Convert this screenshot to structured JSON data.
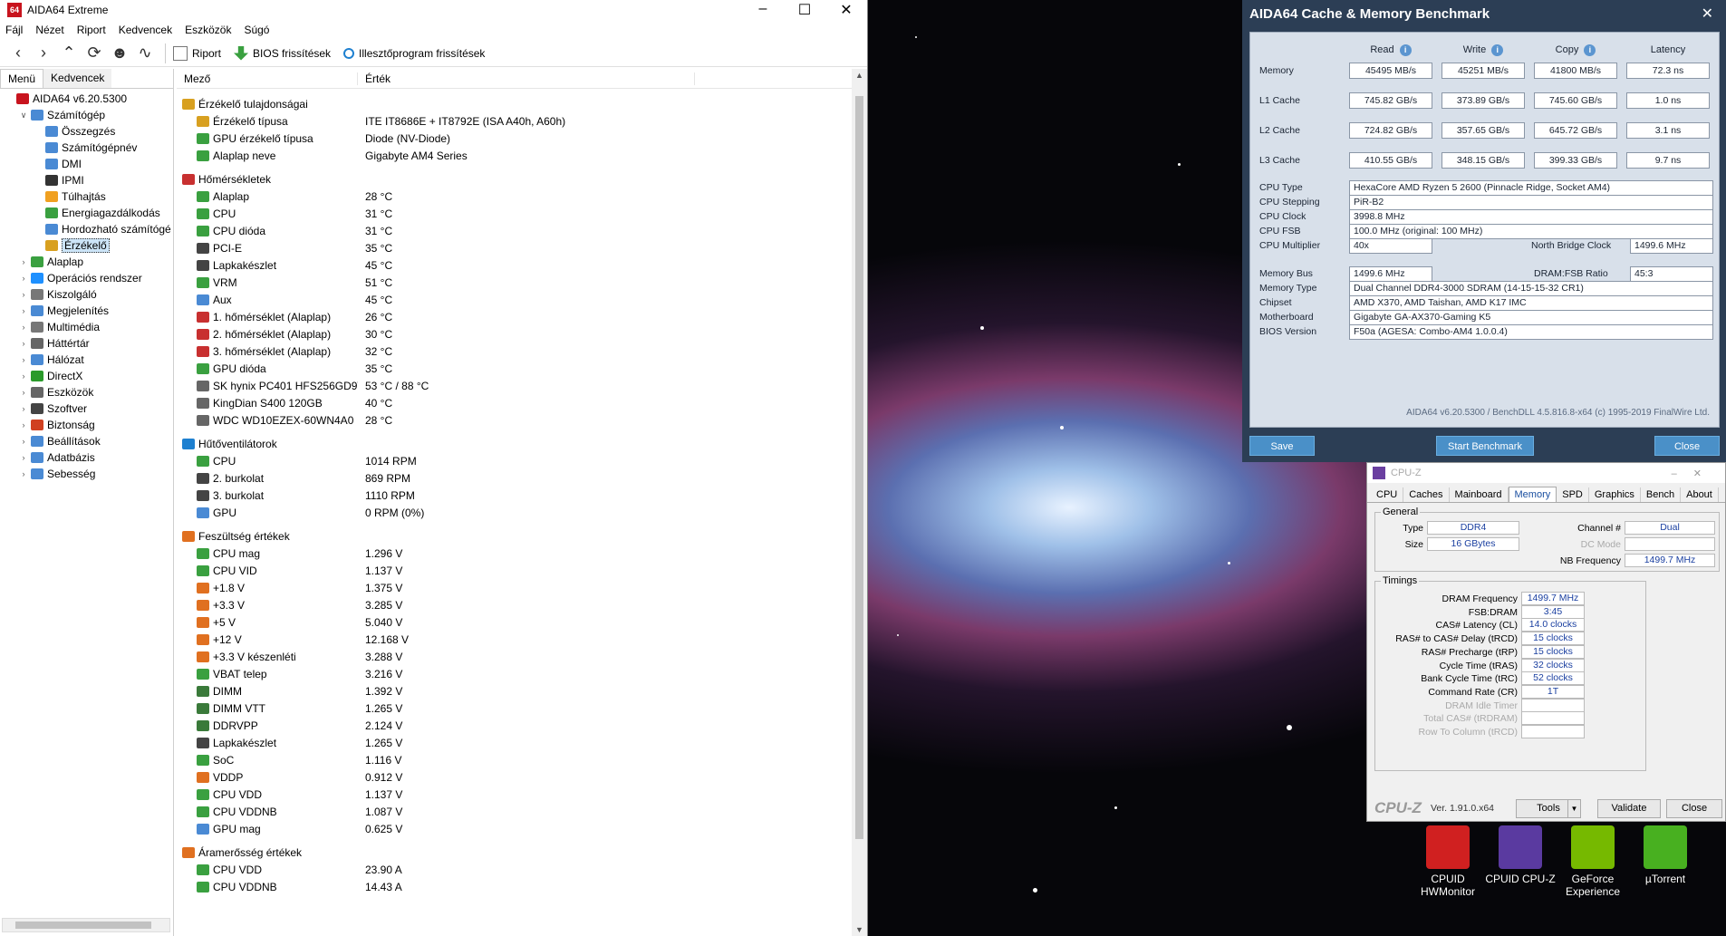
{
  "aida": {
    "title": "AIDA64 Extreme",
    "app_icon_text": "64",
    "menu": [
      "Fájl",
      "Nézet",
      "Riport",
      "Kedvencek",
      "Eszközök",
      "Súgó"
    ],
    "toolbar": {
      "report": "Riport",
      "bios_update": "BIOS frissítések",
      "driver_update": "Illesztőprogram frissítések"
    },
    "tabs": {
      "menu": "Menü",
      "favorites": "Kedvencek"
    },
    "tree": [
      {
        "label": "AIDA64 v6.20.5300",
        "indent": 0,
        "exp": "",
        "color": "#c8141e"
      },
      {
        "label": "Számítógép",
        "indent": 1,
        "exp": "v",
        "color": "#4a8ad4"
      },
      {
        "label": "Összegzés",
        "indent": 2,
        "exp": "",
        "color": "#4a8ad4"
      },
      {
        "label": "Számítógépnév",
        "indent": 2,
        "exp": "",
        "color": "#4a8ad4"
      },
      {
        "label": "DMI",
        "indent": 2,
        "exp": "",
        "color": "#4a8ad4"
      },
      {
        "label": "IPMI",
        "indent": 2,
        "exp": "",
        "color": "#333"
      },
      {
        "label": "Túlhajtás",
        "indent": 2,
        "exp": "",
        "color": "#f0a020"
      },
      {
        "label": "Energiagazdálkodás",
        "indent": 2,
        "exp": "",
        "color": "#3aa040"
      },
      {
        "label": "Hordozható számítógé",
        "indent": 2,
        "exp": "",
        "color": "#4a8ad4"
      },
      {
        "label": "Érzékelő",
        "indent": 2,
        "exp": "",
        "color": "#d8a020",
        "selected": true
      },
      {
        "label": "Alaplap",
        "indent": 1,
        "exp": ">",
        "color": "#3aa040"
      },
      {
        "label": "Operációs rendszer",
        "indent": 1,
        "exp": ">",
        "color": "#1e90ff"
      },
      {
        "label": "Kiszolgáló",
        "indent": 1,
        "exp": ">",
        "color": "#777"
      },
      {
        "label": "Megjelenítés",
        "indent": 1,
        "exp": ">",
        "color": "#4a8ad4"
      },
      {
        "label": "Multimédia",
        "indent": 1,
        "exp": ">",
        "color": "#777"
      },
      {
        "label": "Háttértár",
        "indent": 1,
        "exp": ">",
        "color": "#666"
      },
      {
        "label": "Hálózat",
        "indent": 1,
        "exp": ">",
        "color": "#4a8ad4"
      },
      {
        "label": "DirectX",
        "indent": 1,
        "exp": ">",
        "color": "#2a9a2a"
      },
      {
        "label": "Eszközök",
        "indent": 1,
        "exp": ">",
        "color": "#666"
      },
      {
        "label": "Szoftver",
        "indent": 1,
        "exp": ">",
        "color": "#444"
      },
      {
        "label": "Biztonság",
        "indent": 1,
        "exp": ">",
        "color": "#d04020"
      },
      {
        "label": "Beállítások",
        "indent": 1,
        "exp": ">",
        "color": "#4a8ad4"
      },
      {
        "label": "Adatbázis",
        "indent": 1,
        "exp": ">",
        "color": "#4a8ad4"
      },
      {
        "label": "Sebesség",
        "indent": 1,
        "exp": ">",
        "color": "#4a8ad4"
      }
    ],
    "columns": {
      "field": "Mező",
      "value": "Érték"
    },
    "rows": [
      {
        "grp": true,
        "f": "Érzékelő tulajdonságai",
        "v": "",
        "color": "#d8a020"
      },
      {
        "f": "Érzékelő típusa",
        "v": "ITE IT8686E + IT8792E  (ISA A40h, A60h)",
        "color": "#d8a020"
      },
      {
        "f": "GPU érzékelő típusa",
        "v": "Diode  (NV-Diode)",
        "color": "#3aa040"
      },
      {
        "f": "Alaplap neve",
        "v": "Gigabyte AM4 Series",
        "color": "#3aa040"
      },
      {
        "grp": true,
        "f": "Hőmérsékletek",
        "v": "",
        "color": "#c83030"
      },
      {
        "f": "Alaplap",
        "v": "28 °C",
        "color": "#3aa040"
      },
      {
        "f": "CPU",
        "v": "31 °C",
        "color": "#3aa040"
      },
      {
        "f": "CPU dióda",
        "v": "31 °C",
        "color": "#3aa040"
      },
      {
        "f": "PCI-E",
        "v": "35 °C",
        "color": "#444"
      },
      {
        "f": "Lapkakészlet",
        "v": "45 °C",
        "color": "#444"
      },
      {
        "f": "VRM",
        "v": "51 °C",
        "color": "#3aa040"
      },
      {
        "f": "Aux",
        "v": "45 °C",
        "color": "#4a8ad4"
      },
      {
        "f": "1. hőmérséklet (Alaplap)",
        "v": "26 °C",
        "color": "#c83030"
      },
      {
        "f": "2. hőmérséklet (Alaplap)",
        "v": "30 °C",
        "color": "#c83030"
      },
      {
        "f": "3. hőmérséklet (Alaplap)",
        "v": "32 °C",
        "color": "#c83030"
      },
      {
        "f": "GPU dióda",
        "v": "35 °C",
        "color": "#3aa040"
      },
      {
        "f": "SK hynix PC401 HFS256GD9T...",
        "v": "53 °C / 88 °C",
        "color": "#666"
      },
      {
        "f": "KingDian S400 120GB",
        "v": "40 °C",
        "color": "#666"
      },
      {
        "f": "WDC WD10EZEX-60WN4A0",
        "v": "28 °C",
        "color": "#666"
      },
      {
        "grp": true,
        "f": "Hűtőventilátorok",
        "v": "",
        "color": "#1e80d0"
      },
      {
        "f": "CPU",
        "v": "1014 RPM",
        "color": "#3aa040"
      },
      {
        "f": "2. burkolat",
        "v": "869 RPM",
        "color": "#444"
      },
      {
        "f": "3. burkolat",
        "v": "1110 RPM",
        "color": "#444"
      },
      {
        "f": "GPU",
        "v": "0 RPM  (0%)",
        "color": "#4a8ad4"
      },
      {
        "grp": true,
        "f": "Feszültség értékek",
        "v": "",
        "color": "#e07020"
      },
      {
        "f": "CPU mag",
        "v": "1.296 V",
        "color": "#3aa040"
      },
      {
        "f": "CPU VID",
        "v": "1.137 V",
        "color": "#3aa040"
      },
      {
        "f": "+1.8 V",
        "v": "1.375 V",
        "color": "#e07020"
      },
      {
        "f": "+3.3 V",
        "v": "3.285 V",
        "color": "#e07020"
      },
      {
        "f": "+5 V",
        "v": "5.040 V",
        "color": "#e07020"
      },
      {
        "f": "+12 V",
        "v": "12.168 V",
        "color": "#e07020"
      },
      {
        "f": "+3.3 V készenléti",
        "v": "3.288 V",
        "color": "#e07020"
      },
      {
        "f": "VBAT telep",
        "v": "3.216 V",
        "color": "#3aa040"
      },
      {
        "f": "DIMM",
        "v": "1.392 V",
        "color": "#3a7a3a"
      },
      {
        "f": "DIMM VTT",
        "v": "1.265 V",
        "color": "#3a7a3a"
      },
      {
        "f": "DDRVPP",
        "v": "2.124 V",
        "color": "#3a7a3a"
      },
      {
        "f": "Lapkakészlet",
        "v": "1.265 V",
        "color": "#444"
      },
      {
        "f": "SoC",
        "v": "1.116 V",
        "color": "#3aa040"
      },
      {
        "f": "VDDP",
        "v": "0.912 V",
        "color": "#e07020"
      },
      {
        "f": "CPU VDD",
        "v": "1.137 V",
        "color": "#3aa040"
      },
      {
        "f": "CPU VDDNB",
        "v": "1.087 V",
        "color": "#3aa040"
      },
      {
        "f": "GPU mag",
        "v": "0.625 V",
        "color": "#4a8ad4"
      },
      {
        "grp": true,
        "f": "Áramerősség értékek",
        "v": "",
        "color": "#e07020"
      },
      {
        "f": "CPU VDD",
        "v": "23.90 A",
        "color": "#3aa040"
      },
      {
        "f": "CPU VDDNB",
        "v": "14.43 A",
        "color": "#3aa040"
      }
    ]
  },
  "bench": {
    "title": "AIDA64 Cache & Memory Benchmark",
    "headers": [
      "Read",
      "Write",
      "Copy",
      "Latency"
    ],
    "rows": [
      {
        "label": "Memory",
        "values": [
          "45495 MB/s",
          "45251 MB/s",
          "41800 MB/s",
          "72.3 ns"
        ]
      },
      {
        "label": "L1 Cache",
        "values": [
          "745.82 GB/s",
          "373.89 GB/s",
          "745.60 GB/s",
          "1.0 ns"
        ]
      },
      {
        "label": "L2 Cache",
        "values": [
          "724.82 GB/s",
          "357.65 GB/s",
          "645.72 GB/s",
          "3.1 ns"
        ]
      },
      {
        "label": "L3 Cache",
        "values": [
          "410.55 GB/s",
          "348.15 GB/s",
          "399.33 GB/s",
          "9.7 ns"
        ]
      }
    ],
    "cpu_type_label": "CPU Type",
    "cpu_type": "HexaCore AMD Ryzen 5 2600  (Pinnacle Ridge, Socket AM4)",
    "cpu_stepping_label": "CPU Stepping",
    "cpu_stepping": "PiR-B2",
    "cpu_clock_label": "CPU Clock",
    "cpu_clock": "3998.8 MHz",
    "cpu_fsb_label": "CPU FSB",
    "cpu_fsb": "100.0 MHz  (original: 100 MHz)",
    "cpu_mult_label": "CPU Multiplier",
    "cpu_mult": "40x",
    "nb_clock_label": "North Bridge Clock",
    "nb_clock": "1499.6 MHz",
    "mem_bus_label": "Memory Bus",
    "mem_bus": "1499.6 MHz",
    "dram_ratio_label": "DRAM:FSB Ratio",
    "dram_ratio": "45:3",
    "mem_type_label": "Memory Type",
    "mem_type": "Dual Channel DDR4-3000 SDRAM  (14-15-15-32 CR1)",
    "chipset_label": "Chipset",
    "chipset": "AMD X370, AMD Taishan, AMD K17 IMC",
    "mobo_label": "Motherboard",
    "mobo": "Gigabyte GA-AX370-Gaming K5",
    "bios_label": "BIOS Version",
    "bios": "F50a  (AGESA: Combo-AM4 1.0.0.4)",
    "footer": "AIDA64 v6.20.5300 / BenchDLL 4.5.816.8-x64  (c) 1995-2019 FinalWire Ltd.",
    "save": "Save",
    "start": "Start Benchmark",
    "close": "Close"
  },
  "cpuz": {
    "title": "CPU-Z",
    "tabs": [
      "CPU",
      "Caches",
      "Mainboard",
      "Memory",
      "SPD",
      "Graphics",
      "Bench",
      "About"
    ],
    "active_tab": "Memory",
    "general_legend": "General",
    "type_label": "Type",
    "type": "DDR4",
    "size_label": "Size",
    "size": "16 GBytes",
    "channel_label": "Channel #",
    "channel": "Dual",
    "dcmode_label": "DC Mode",
    "dcmode": "",
    "nbfreq_label": "NB Frequency",
    "nbfreq": "1499.7 MHz",
    "timings_legend": "Timings",
    "timings": [
      {
        "label": "DRAM Frequency",
        "value": "1499.7 MHz",
        "dim": false
      },
      {
        "label": "FSB:DRAM",
        "value": "3:45",
        "dim": false
      },
      {
        "label": "CAS# Latency (CL)",
        "value": "14.0 clocks",
        "dim": false
      },
      {
        "label": "RAS# to CAS# Delay (tRCD)",
        "value": "15 clocks",
        "dim": false
      },
      {
        "label": "RAS# Precharge (tRP)",
        "value": "15 clocks",
        "dim": false
      },
      {
        "label": "Cycle Time (tRAS)",
        "value": "32 clocks",
        "dim": false
      },
      {
        "label": "Bank Cycle Time (tRC)",
        "value": "52 clocks",
        "dim": false
      },
      {
        "label": "Command Rate (CR)",
        "value": "1T",
        "dim": false
      },
      {
        "label": "DRAM Idle Timer",
        "value": "",
        "dim": true
      },
      {
        "label": "Total CAS# (tRDRAM)",
        "value": "",
        "dim": true
      },
      {
        "label": "Row To Column (tRCD)",
        "value": "",
        "dim": true
      }
    ],
    "logo": "CPU-Z",
    "version": "Ver. 1.91.0.x64",
    "tools": "Tools",
    "validate": "Validate",
    "close": "Close"
  },
  "desktop": [
    {
      "label": "CPUID HWMonitor",
      "icon": "hwmonitor-icon",
      "color": "#d02020"
    },
    {
      "label": "CPUID CPU-Z",
      "icon": "cpuz-icon",
      "color": "#5a3aa0"
    },
    {
      "label": "GeForce Experience",
      "icon": "geforce-icon",
      "color": "#76b900"
    },
    {
      "label": "µTorrent",
      "icon": "utorrent-icon",
      "color": "#48b020"
    }
  ]
}
